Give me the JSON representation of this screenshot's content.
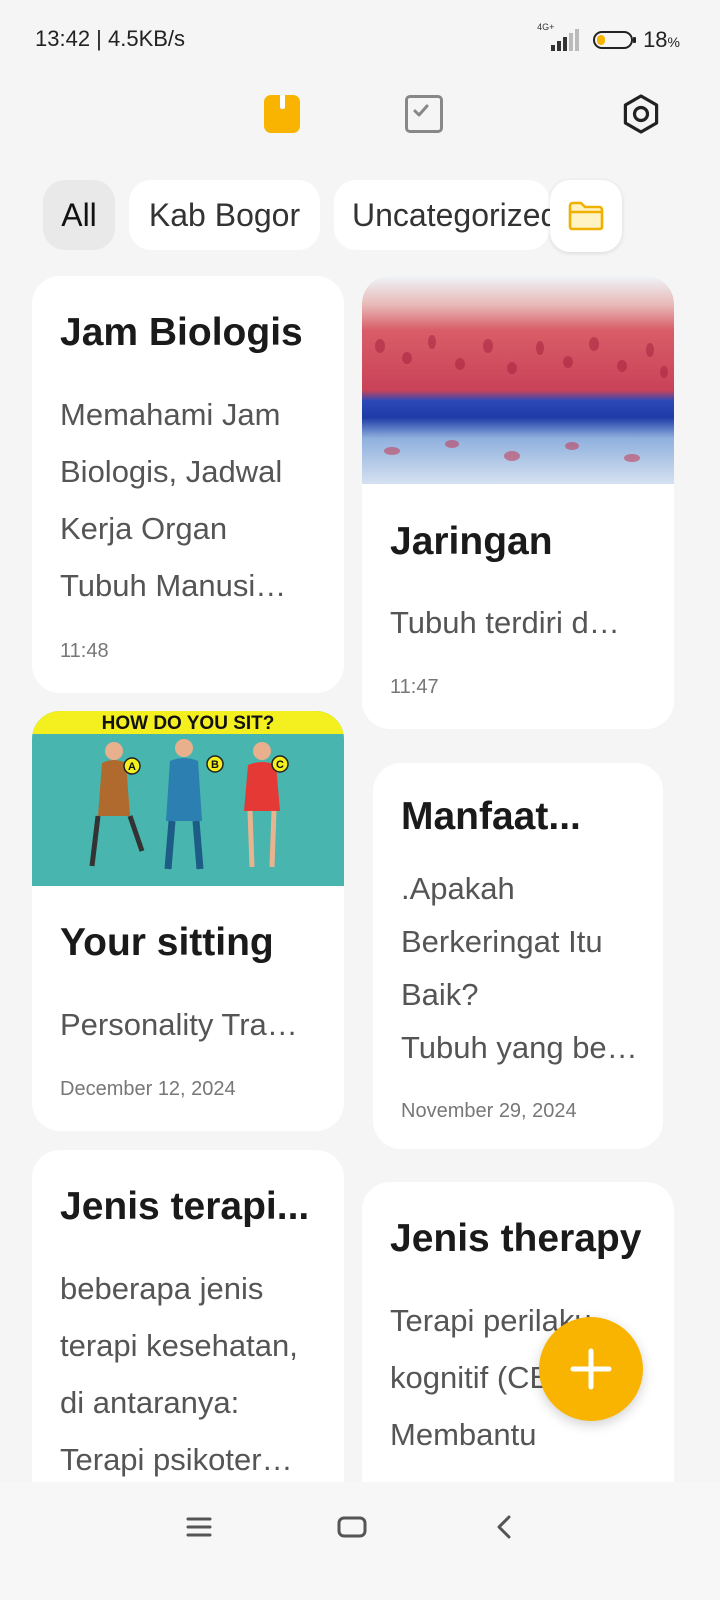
{
  "status_bar": {
    "time": "13:42 | 4.5KB/s",
    "network": "4G+",
    "battery_level": 0.18,
    "battery_label": "18",
    "battery_unit": "%"
  },
  "toolbar": {
    "notes_icon": "notes-icon",
    "tasks_icon": "tasks-icon",
    "settings_icon": "settings-icon"
  },
  "categories": {
    "items": [
      {
        "label": "All",
        "active": true
      },
      {
        "label": "Kab Bogor",
        "active": false
      },
      {
        "label": "Uncategorized",
        "active": false
      }
    ],
    "folder_icon": "folder-icon"
  },
  "notes": [
    {
      "title": "Jam Biologis",
      "lines": [
        "Memahami Jam",
        "Biologis, Jadwal",
        "Kerja Organ",
        "Tubuh Manusi…"
      ],
      "date": "11:48"
    },
    {
      "title": "Jaringan",
      "lines": [
        "Tubuh terdiri d…"
      ],
      "date": "11:47"
    },
    {
      "title": "Your sitting",
      "lines": [
        "Personality Tra…"
      ],
      "date": "December 12, 2024",
      "image_caption": "HOW DO YOU SIT?",
      "image_labels": [
        "A",
        "B",
        "C"
      ]
    },
    {
      "title": "Manfaat...",
      "lines": [
        ".Apakah",
        "Berkeringat Itu",
        "Baik?",
        "Tubuh yang be…"
      ],
      "date": "November 29, 2024"
    },
    {
      "title": "Jenis terapi...",
      "lines": [
        "beberapa jenis",
        "terapi kesehatan,",
        "di antaranya:",
        "Terapi psikoter…"
      ],
      "date": ""
    },
    {
      "title": "Jenis therapy",
      "lines": [
        "Terapi perilaku",
        "kognitif (CBT):",
        "Membantu"
      ],
      "date": ""
    }
  ],
  "fab": {
    "icon": "plus-icon"
  },
  "nav": {
    "menu_icon": "menu-icon",
    "home_icon": "home-icon",
    "back_icon": "back-icon"
  },
  "colors": {
    "accent": "#f8b400",
    "background": "#f5f5f5",
    "card": "#ffffff",
    "chip_active": "#e9e9e9"
  }
}
